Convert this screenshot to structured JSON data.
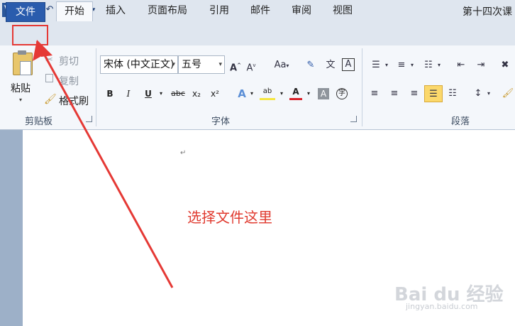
{
  "title_bar": {
    "app_logo_letter": "W",
    "document_title": "第十四次课"
  },
  "tabs": [
    {
      "label": "文件"
    },
    {
      "label": "开始"
    },
    {
      "label": "插入"
    },
    {
      "label": "页面布局"
    },
    {
      "label": "引用"
    },
    {
      "label": "邮件"
    },
    {
      "label": "审阅"
    },
    {
      "label": "视图"
    }
  ],
  "clipboard": {
    "paste_label": "粘贴",
    "cut_label": "剪切",
    "copy_label": "复制",
    "format_painter_label": "格式刷",
    "group_label": "剪贴板"
  },
  "font": {
    "font_name": "宋体 (中文正文)",
    "font_size": "五号",
    "bold": "B",
    "italic": "I",
    "underline": "U",
    "strikethrough": "abc",
    "subscript": "x₂",
    "superscript": "x²",
    "case_label": "Aa",
    "group_label": "字体"
  },
  "paragraph": {
    "group_label": "段落"
  },
  "document": {
    "paragraph_mark": "↵"
  },
  "annotation": {
    "text": "选择文件这里",
    "color": "#e03a2f"
  },
  "watermark": {
    "text": "Bai du 经验",
    "url": "jingyan.baidu.com"
  }
}
